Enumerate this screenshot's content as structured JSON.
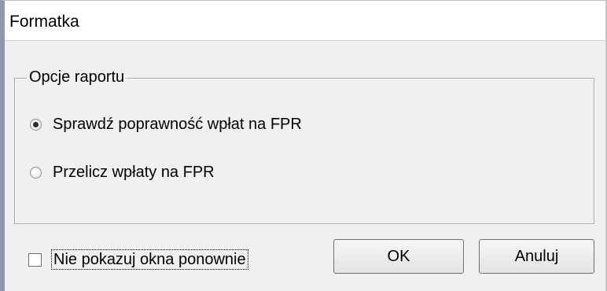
{
  "window": {
    "title": "Formatka"
  },
  "group": {
    "legend": "Opcje raportu"
  },
  "options": [
    {
      "label": "Sprawdź poprawność wpłat na FPR",
      "checked": true
    },
    {
      "label": "Przelicz wpłaty na FPR",
      "checked": false
    }
  ],
  "checkbox": {
    "label": "Nie pokazuj okna ponownie",
    "checked": false
  },
  "buttons": {
    "ok_label": "OK",
    "cancel_label": "Anuluj"
  }
}
